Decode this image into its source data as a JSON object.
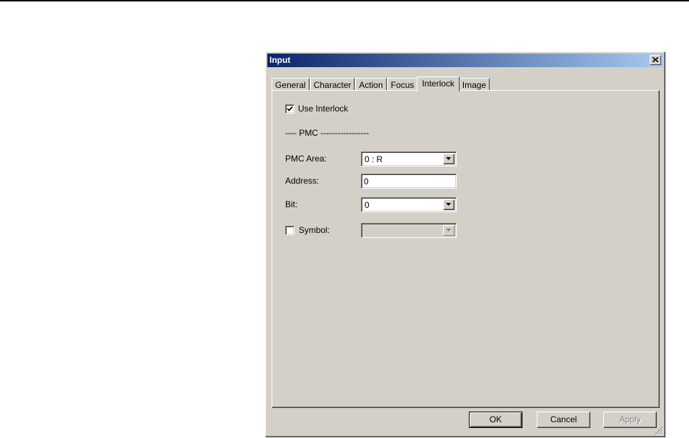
{
  "dialog": {
    "title": "Input",
    "close_label": "×"
  },
  "tabs": [
    {
      "label": "General"
    },
    {
      "label": "Character"
    },
    {
      "label": "Action"
    },
    {
      "label": "Focus"
    },
    {
      "label": "Interlock"
    },
    {
      "label": "Image"
    }
  ],
  "active_tab": "Interlock",
  "interlock": {
    "use_interlock_label": "Use Interlock",
    "use_interlock_checked": true,
    "section_label": "---- PMC -----------------",
    "pmc_area_label": "PMC Area:",
    "pmc_area_value": "0 : R",
    "address_label": "Address:",
    "address_value": "0",
    "bit_label": "Bit:",
    "bit_value": "0",
    "symbol_label": "Symbol:",
    "symbol_checked": false,
    "symbol_value": ""
  },
  "buttons": {
    "ok_label": "OK",
    "cancel_label": "Cancel",
    "apply_label": "Apply"
  },
  "colors": {
    "face": "#d4d0c8",
    "title_start": "#0a246a",
    "title_end": "#a6caf0"
  },
  "icons": {
    "close": "close-icon",
    "dropdown": "chevron-down-icon",
    "check": "checkmark-icon",
    "grip": "resize-grip-icon"
  }
}
